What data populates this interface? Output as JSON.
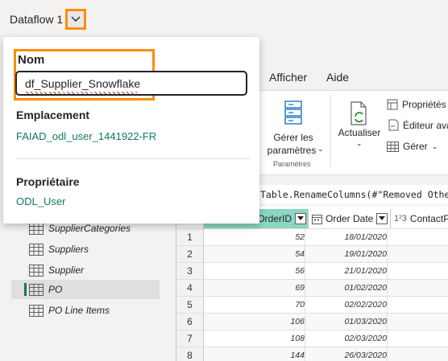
{
  "titlebar": {
    "title": "Dataflow 1"
  },
  "ribbon": {
    "tabs": [
      "Afficher",
      "Aide"
    ],
    "manage_params_line1": "Gérer les",
    "manage_params_line2": "paramètres",
    "params_group": "Paramètres",
    "refresh_label": "Actualiser",
    "properties": "Propriétés",
    "advanced_editor": "Éditeur ava",
    "manage": "Gérer"
  },
  "formula": {
    "text": "Table.RenameColumns(#\"Removed Other"
  },
  "popup": {
    "name_label": "Nom",
    "name_value": "df_Supplier_Snowflake",
    "location_label": "Emplacement",
    "location_value": "FAIAD_odl_user_1441922-FR",
    "owner_label": "Propriétaire",
    "owner_value": "ODL_User"
  },
  "queries": [
    {
      "label": "SupplierCategories"
    },
    {
      "label": "Suppliers"
    },
    {
      "label": "Supplier"
    },
    {
      "label": "PO"
    },
    {
      "label": "PO Line Items"
    }
  ],
  "grid": {
    "headers": {
      "col1": "OrderID",
      "col2": "Order Date",
      "col3": "ContactPe",
      "col3_type": "1²3"
    },
    "rows": [
      {
        "n": "1",
        "id": "52",
        "date": "18/01/2020"
      },
      {
        "n": "2",
        "id": "54",
        "date": "19/01/2020"
      },
      {
        "n": "3",
        "id": "56",
        "date": "21/01/2020"
      },
      {
        "n": "4",
        "id": "69",
        "date": "01/02/2020"
      },
      {
        "n": "5",
        "id": "70",
        "date": "02/02/2020"
      },
      {
        "n": "6",
        "id": "106",
        "date": "01/03/2020"
      },
      {
        "n": "7",
        "id": "108",
        "date": "02/03/2020"
      },
      {
        "n": "8",
        "id": "144",
        "date": "26/03/2020"
      }
    ]
  },
  "colors": {
    "accent": "#117865",
    "highlight": "#ff8c00",
    "key_header": "#8bd6c4"
  }
}
